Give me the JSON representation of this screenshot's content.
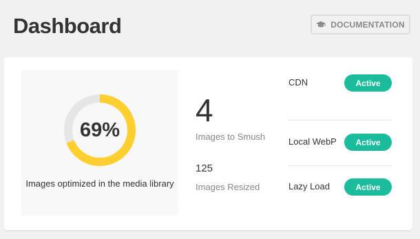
{
  "header": {
    "title": "Dashboard",
    "documentation_label": "DOCUMENTATION",
    "documentation_icon": "graduation-cap-icon"
  },
  "score": {
    "percent": 69,
    "percent_label": "69%",
    "caption": "Images optimized in the media library",
    "ring_color": "#fecf2f",
    "track_color": "#e6e6e6"
  },
  "stats": {
    "to_smush_value": "4",
    "to_smush_label": "Images to Smush",
    "resized_value": "125",
    "resized_label": "Images Resized"
  },
  "features": [
    {
      "label": "CDN",
      "status": "Active"
    },
    {
      "label": "Local WebP",
      "status": "Active"
    },
    {
      "label": "Lazy Load",
      "status": "Active"
    }
  ],
  "colors": {
    "active_badge": "#1abc9c"
  }
}
